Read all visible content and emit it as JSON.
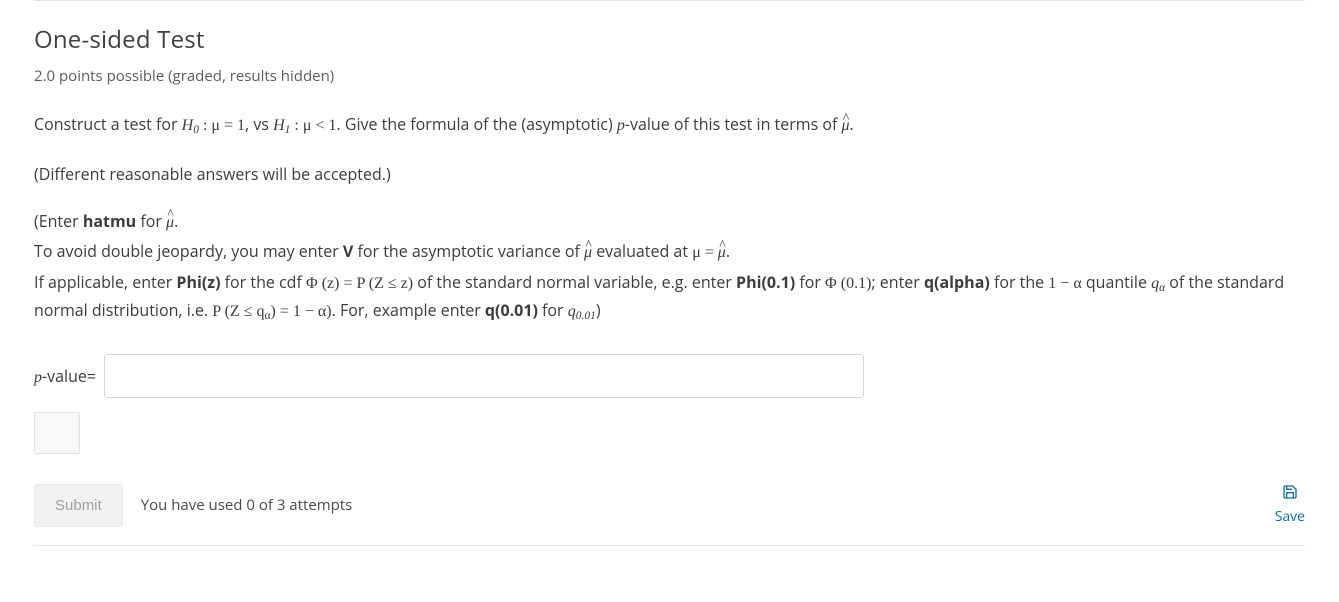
{
  "title": "One-sided Test",
  "points_line": "2.0 points possible (graded, results hidden)",
  "prompt": {
    "prefix": "Construct a test for ",
    "h0_name": "H",
    "h0_sub": "0",
    "colon_mu_eq": " : μ = 1",
    "vs": ", vs ",
    "h1_name": "H",
    "h1_sub": "1",
    "colon_mu_lt": " : μ < 1",
    "after": ". Give the formula of the (asymptotic) ",
    "pword": "p",
    "after2": "-value of this test in terms of ",
    "muhat": "μ",
    "period": "."
  },
  "note": "(Different reasonable answers will be accepted.)",
  "instr": {
    "l1a": "(Enter ",
    "l1b": "hatmu",
    "l1c": " for ",
    "l1_muhat": "μ",
    "l1d": ".",
    "l2a": "To avoid double jeopardy, you may enter ",
    "l2V": "V",
    "l2b": " for the asymptotic variance of ",
    "l2_muhat": "μ",
    "l2c": " evaluated at ",
    "l2_eq_lhs": "μ = ",
    "l2_eq_rhs": "μ",
    "l2d": ".",
    "l3a": "If applicable, enter ",
    "l3Phi": "Phi(z)",
    "l3b": " for the cdf ",
    "l3_phiz": "Φ (z) = P (Z ≤ z)",
    "l3c": " of the standard normal variable, e.g. enter ",
    "l3Phi01": "Phi(0.1)",
    "l3d": " for ",
    "l3_phi01m": "Φ (0.1)",
    "l3e": "; enter ",
    "l3qalpha": "q(alpha)",
    "l3f": " for the ",
    "l4a_expr": "1 − α",
    "l4b": " quantile ",
    "l4_qalpha": "q",
    "l4_qalpha_sub": "α",
    "l4c": " of the standard normal distribution, i.e. ",
    "l4_expr": "P (Z ≤ q",
    "l4_expr_sub": "α",
    "l4_expr2": ") = 1 − α)",
    "l4d": ". For, example enter ",
    "l4q001": "q(0.01)",
    "l4e": " for ",
    "l4_q001m": "q",
    "l4_q001m_sub": "0.01",
    "l4f": ")"
  },
  "answer": {
    "label_p": "p",
    "label_rest": "-value=",
    "value": ""
  },
  "footer": {
    "submit": "Submit",
    "attempts": "You have used 0 of 3 attempts",
    "save": "Save"
  }
}
